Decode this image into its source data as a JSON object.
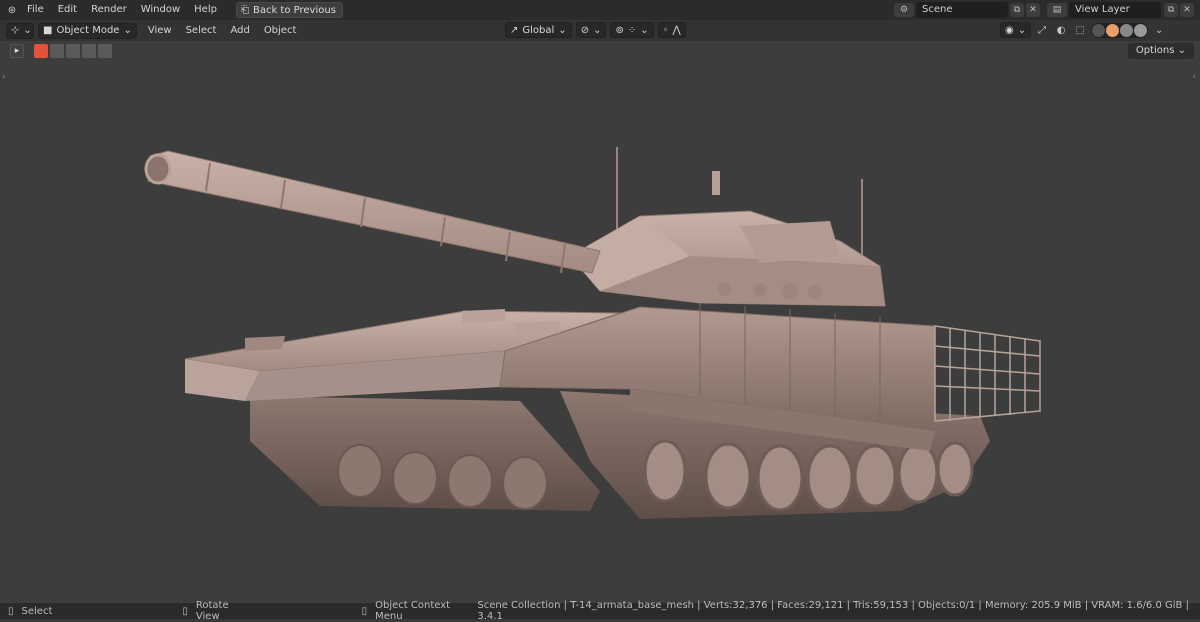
{
  "topbar": {
    "menus": [
      "File",
      "Edit",
      "Render",
      "Window",
      "Help"
    ],
    "back_label": "Back to Previous",
    "scene_label": "Scene",
    "view_layer_label": "View Layer"
  },
  "header": {
    "mode_label": "Object Mode",
    "menus": [
      "View",
      "Select",
      "Add",
      "Object"
    ],
    "orientation_label": "Global",
    "options_label": "Options"
  },
  "status": {
    "select_label": "Select",
    "rotate_label": "Rotate View",
    "context_label": "Object Context Menu",
    "stats": "Scene Collection | T-14_armata_base_mesh | Verts:32,376 | Faces:29,121 | Tris:59,153 | Objects:0/1 | Memory: 205.9 MiB | VRAM: 1.6/6.0 GiB | 3.4.1"
  },
  "colors": {
    "accent_shading": "#e8a06a",
    "tool_active": "#e2543a",
    "model": "#a48a80"
  }
}
